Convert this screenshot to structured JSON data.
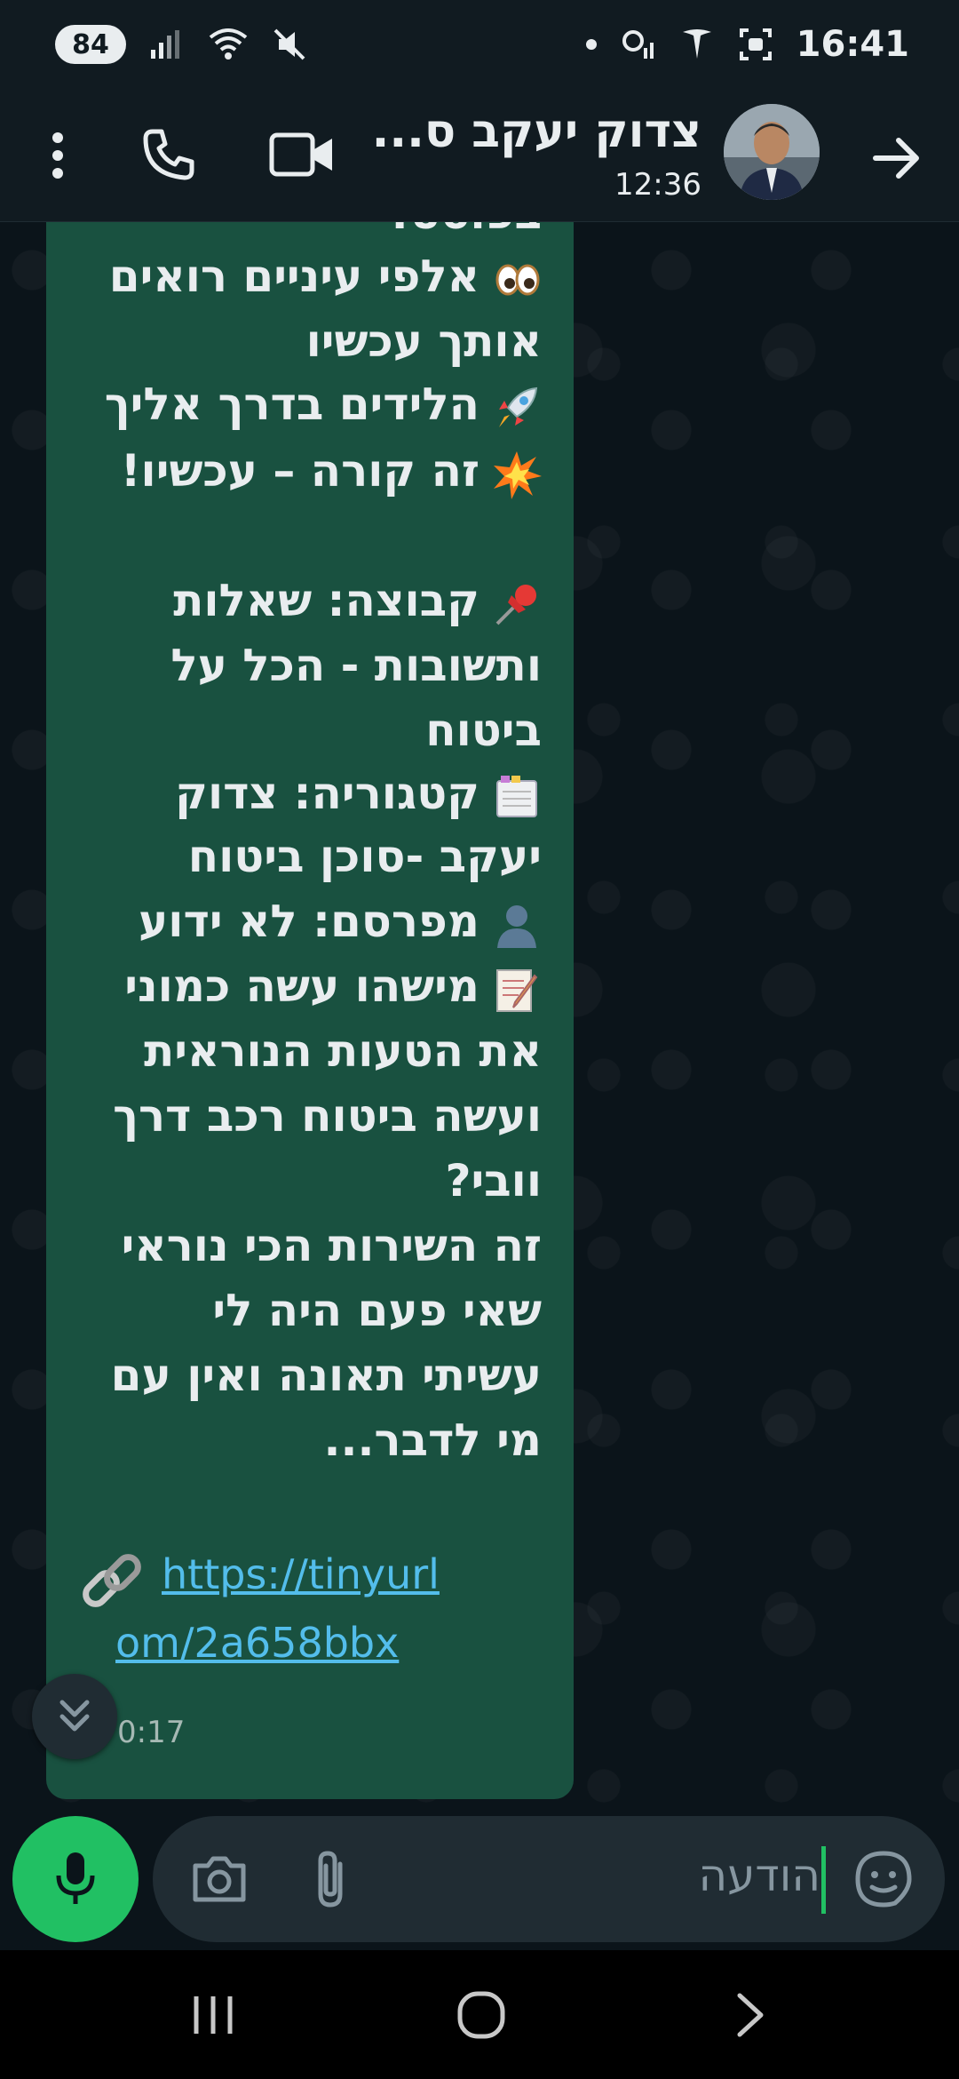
{
  "status_bar": {
    "battery": "84",
    "time": "16:41"
  },
  "header": {
    "contact_name": "צדוק יעקב ס...",
    "subtitle": "12:36"
  },
  "message": {
    "lines": [
      {
        "text": "בפוסט!",
        "emoji": ""
      },
      {
        "text": "אלפי עיניים רואים",
        "emoji": "eyes-emoji"
      },
      {
        "text": "אותך עכשיו",
        "emoji": ""
      },
      {
        "text": "הלידים בדרך אליך",
        "emoji": "rocket-emoji"
      },
      {
        "text": "זה קורה – עכשיו!",
        "emoji": "collision-emoji"
      },
      {
        "text": "",
        "emoji": ""
      },
      {
        "text": "קבוצה: שאלות",
        "emoji": "pushpin-emoji"
      },
      {
        "text": "ותשובות - הכל על",
        "emoji": ""
      },
      {
        "text": "ביטוח",
        "emoji": ""
      },
      {
        "text": "קטגוריה: צדוק",
        "emoji": "card-index-emoji"
      },
      {
        "text": "יעקב -סוכן ביטוח",
        "emoji": ""
      },
      {
        "text": "מפרסם: לא ידוע",
        "emoji": "silhouette-emoji"
      },
      {
        "text": "מישהו עשה כמוני",
        "emoji": "memo-emoji"
      },
      {
        "text": "את הטעות הנוראית",
        "emoji": ""
      },
      {
        "text": "ועשה ביטוח רכב דרך",
        "emoji": ""
      },
      {
        "text": "וובי?",
        "emoji": ""
      },
      {
        "text": "זה השירות הכי נוראי",
        "emoji": ""
      },
      {
        "text": "שאי פעם היה לי",
        "emoji": ""
      },
      {
        "text": "עשיתי תאונה ואין עם",
        "emoji": ""
      },
      {
        "text": "מי לדבר...",
        "emoji": ""
      }
    ],
    "link_line1": "https://tinyurl",
    "link_line2": "om/2a658bbx",
    "time": "0:17"
  },
  "input": {
    "placeholder": "הודעה"
  },
  "colors": {
    "bubble": "#195140",
    "accent_green": "#21c063",
    "link": "#53bdeb",
    "background": "#0b141a"
  }
}
